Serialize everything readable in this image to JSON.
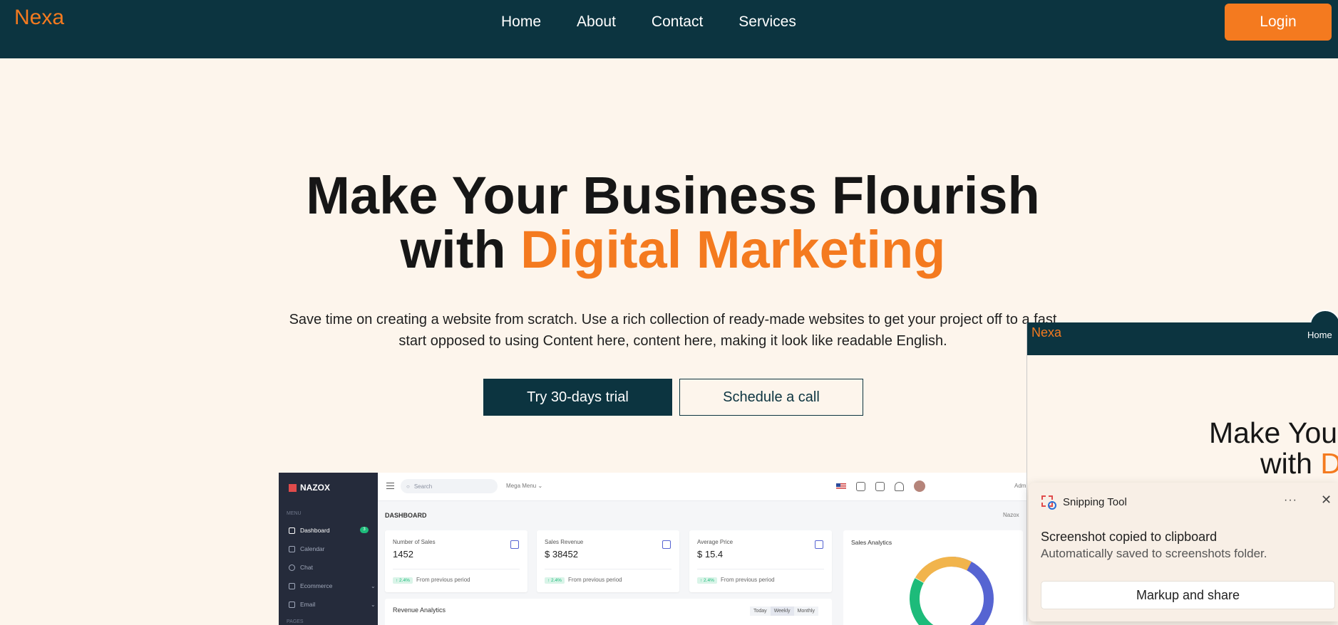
{
  "nav": {
    "brand": "Nexa",
    "links": [
      "Home",
      "About",
      "Contact",
      "Services"
    ],
    "login": "Login"
  },
  "hero": {
    "line1": "Make Your Business Flourish",
    "line2_prefix": "with ",
    "line2_accent": "Digital Marketing",
    "subtitle": "Save time on creating a website from scratch. Use a rich collection of ready-made websites to get your project off to a fast start opposed to using Content here, content here, making it look like readable English.",
    "primary_cta": "Try 30-days trial",
    "secondary_cta": "Schedule a call"
  },
  "dashboard": {
    "logo": "NAZOX",
    "menu_label": "MENU",
    "menu_items": [
      {
        "label": "Dashboard",
        "icon": "grid-icon"
      },
      {
        "label": "Calendar",
        "icon": "calendar-icon"
      },
      {
        "label": "Chat",
        "icon": "chat-icon"
      },
      {
        "label": "Ecommerce",
        "icon": "store-icon"
      },
      {
        "label": "Email",
        "icon": "mail-icon"
      }
    ],
    "dashboard_badge": "3",
    "pages_label": "PAGES",
    "search_placeholder": "Search",
    "mega_menu": "Mega Menu ⌄",
    "user": "Adm",
    "page_heading": "DASHBOARD",
    "breadcrumb": "Nazox",
    "cards": [
      {
        "label": "Number of Sales",
        "value": "1452",
        "change": "↑ 2.4%",
        "note": "From previous period"
      },
      {
        "label": "Sales Revenue",
        "value": "$ 38452",
        "change": "↑ 2.4%",
        "note": "From previous period"
      },
      {
        "label": "Average Price",
        "value": "$ 15.4",
        "change": "↑ 2.4%",
        "note": "From previous period"
      }
    ],
    "revenue_title": "Revenue Analytics",
    "revenue_tabs": [
      "Today",
      "Weekly",
      "Monthly"
    ],
    "sales_analytics_title": "Sales Analytics",
    "donut_colors": [
      "#5664d2",
      "#1dbb7a",
      "#f1b44c"
    ]
  },
  "preview_window": {
    "brand": "Nexa",
    "home": "Home",
    "title_line1": "Make You",
    "title_line2_prefix": "with ",
    "title_line2_accent": "D"
  },
  "toast": {
    "app": "Snipping Tool",
    "more": "···",
    "close": "✕",
    "heading": "Screenshot copied to clipboard",
    "message": "Automatically saved to screenshots folder.",
    "action": "Markup and share"
  },
  "colors": {
    "nav_bg": "#0c3440",
    "accent": "#f47a1f",
    "page_bg": "#fdf5ec"
  }
}
